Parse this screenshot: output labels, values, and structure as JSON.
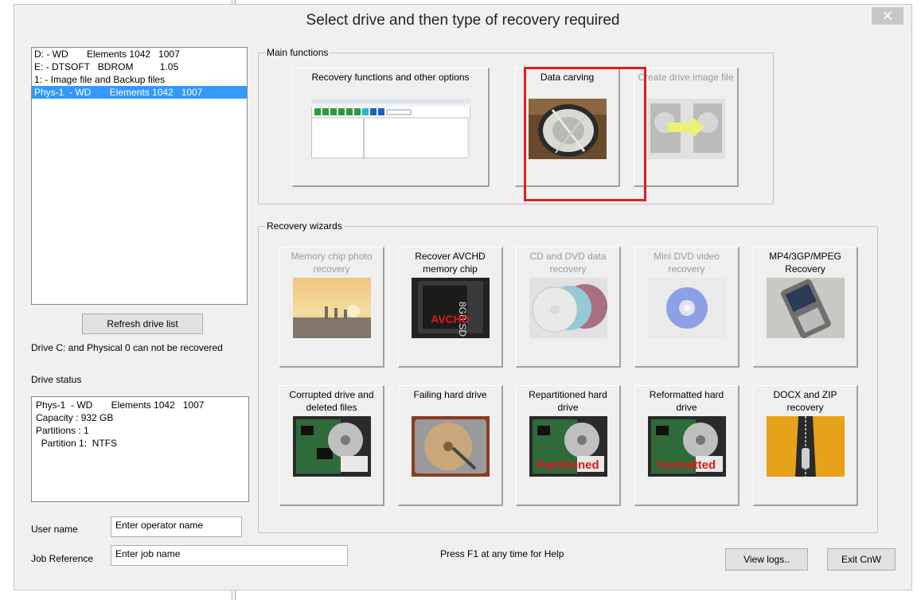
{
  "window": {
    "title": "Select drive and then type of recovery required",
    "close_glyph": "✕"
  },
  "drives": [
    "D: - WD       Elements 1042   1007",
    "E: - DTSOFT   BDROM          1.05",
    "1: - Image file and Backup files",
    "Phys-1  - WD       Elements 1042   1007"
  ],
  "refresh_button": "Refresh drive list",
  "drive_note": "Drive C: and Physical 0 can not be recovered",
  "drive_status": {
    "heading": "Drive status",
    "lines": [
      "Phys-1  - WD       Elements 1042   1007",
      "Capacity : 932 GB",
      "Partitions : 1",
      "  Partition 1:  NTFS"
    ]
  },
  "user": {
    "label": "User name",
    "value": "Enter operator name"
  },
  "job": {
    "label": "Job Reference",
    "value": "Enter job name"
  },
  "help_text": "Press F1 at any time for Help",
  "view_logs_button": "View logs..",
  "exit_button": "Exit CnW",
  "main_functions": {
    "label": "Main functions",
    "tiles": [
      {
        "label": "Recovery functions and other options",
        "icon": "app-window-thumbnail"
      },
      {
        "label": "Data carving",
        "icon": "carving-plate-thumbnail"
      },
      {
        "label": "Create drive image file",
        "icon": "drive-image-thumbnail"
      }
    ]
  },
  "recovery_wizards": {
    "label": "Recovery wizards",
    "tiles": [
      {
        "label": "Memory chip photo recovery",
        "icon": "sunset-photo-thumbnail"
      },
      {
        "label": "Recover AVCHD memory chip",
        "overlay": "AVCHD",
        "card_text": "8GB SD"
      },
      {
        "label": "CD and DVD data recovery",
        "icon": "discs-thumbnail"
      },
      {
        "label": "Mini DVD video recovery",
        "icon": "mini-dvd-thumbnail"
      },
      {
        "label": "MP4/3GP/MPEG Recovery",
        "icon": "phone-thumbnail"
      },
      {
        "label": "Corrupted drive and deleted files",
        "icon": "hard-drive-thumbnail"
      },
      {
        "label": "Failing hard drive",
        "icon": "hard-drive-platter-thumbnail"
      },
      {
        "label": "Repartitioned hard drive",
        "overlay": "Partitioned"
      },
      {
        "label": "Reformatted hard drive",
        "overlay": "Formatted"
      },
      {
        "label": "DOCX and ZIP recovery",
        "icon": "zipper-thumbnail"
      }
    ]
  }
}
